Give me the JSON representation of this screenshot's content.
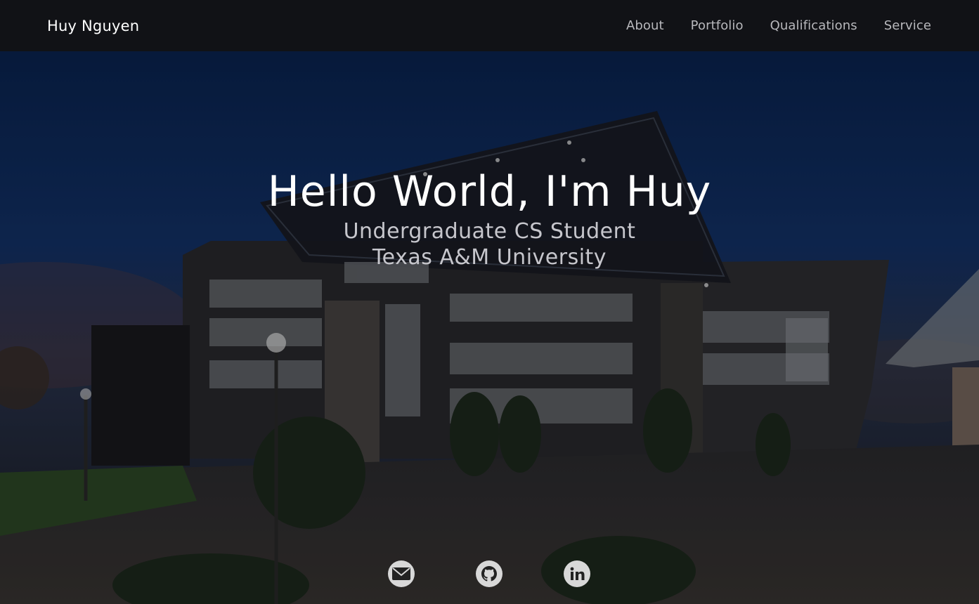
{
  "navbar": {
    "brand": "Huy Nguyen",
    "links": [
      {
        "label": "About"
      },
      {
        "label": "Portfolio"
      },
      {
        "label": "Qualifications"
      },
      {
        "label": "Service"
      }
    ]
  },
  "hero": {
    "title": "Hello World, I'm Huy",
    "subtitle_line1": "Undergraduate CS Student",
    "subtitle_line2": "Texas A&M University"
  },
  "socials": [
    {
      "name": "email",
      "icon": "email-icon"
    },
    {
      "name": "github",
      "icon": "github-icon"
    },
    {
      "name": "linkedin",
      "icon": "linkedin-icon"
    }
  ],
  "colors": {
    "navbar_bg": "#111216",
    "title": "#ffffff",
    "subtitle": "#c6c6cc",
    "nav_link": "#b8b8bc",
    "social_bg": "#d8d8d8"
  }
}
